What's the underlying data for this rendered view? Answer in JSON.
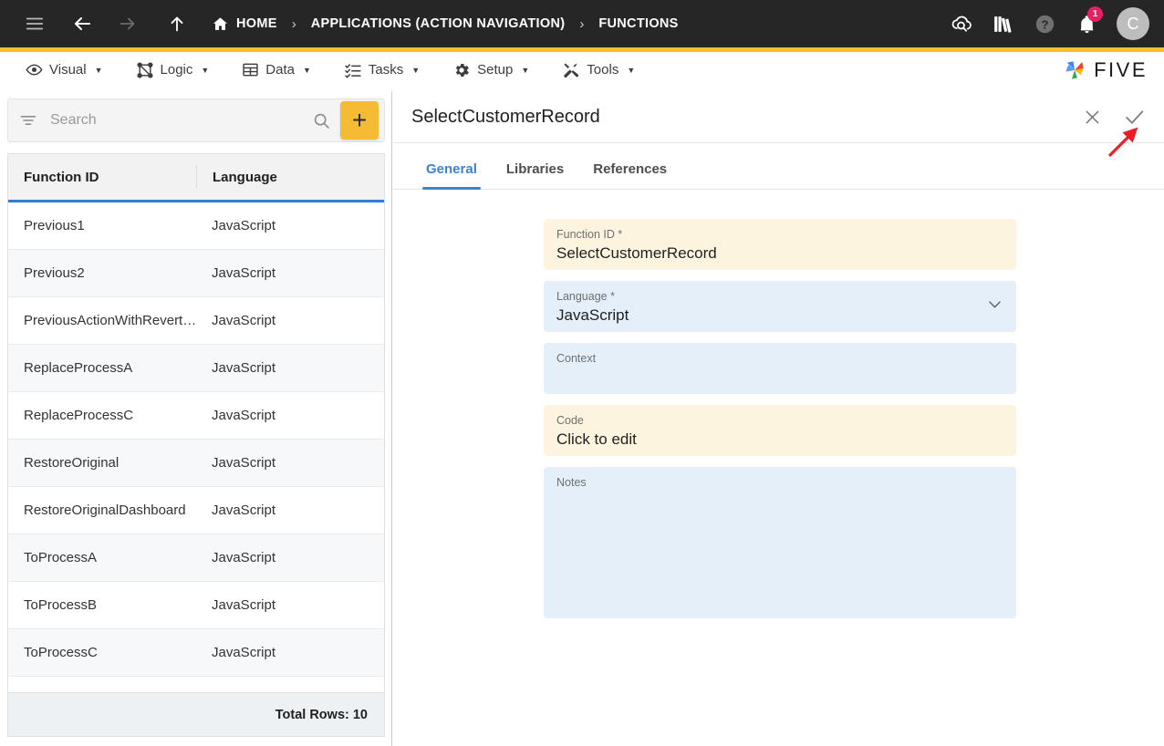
{
  "header": {
    "nav_icons": [
      {
        "name": "menu-icon",
        "label": "Menu"
      },
      {
        "name": "back-arrow-icon",
        "label": "Back"
      },
      {
        "name": "forward-arrow-icon",
        "label": "Forward"
      },
      {
        "name": "up-arrow-icon",
        "label": "Up"
      }
    ],
    "breadcrumb": [
      {
        "label": "HOME",
        "icon": "home-icon"
      },
      {
        "label": "APPLICATIONS (ACTION NAVIGATION)",
        "icon": ""
      },
      {
        "label": "FUNCTIONS",
        "icon": ""
      }
    ],
    "separator": "›",
    "right_icons": [
      {
        "name": "cloud-search-icon",
        "label": "Cloud Search"
      },
      {
        "name": "library-books-icon",
        "label": "Library"
      },
      {
        "name": "help-icon",
        "label": "Help"
      },
      {
        "name": "notifications-bell-icon",
        "label": "Notifications"
      }
    ],
    "notification_count": "1",
    "avatar_initial": "C",
    "accent_color": "#f9bf2c",
    "background_color": "#262626"
  },
  "menubar": {
    "items": [
      {
        "label": "Visual",
        "icon": "eye-icon"
      },
      {
        "label": "Logic",
        "icon": "logic-nodes-icon"
      },
      {
        "label": "Data",
        "icon": "table-grid-icon"
      },
      {
        "label": "Tasks",
        "icon": "checklist-icon"
      },
      {
        "label": "Setup",
        "icon": "gear-icon"
      },
      {
        "label": "Tools",
        "icon": "tools-wrench-icon"
      }
    ],
    "caret": "▼",
    "logo_text": "FIVE"
  },
  "list_panel": {
    "search": {
      "placeholder": "Search",
      "value": "",
      "filter_icon": "filter-icon",
      "search_icon": "search-icon"
    },
    "add_button_label": "+",
    "add_button_color": "#f6bb34",
    "columns": [
      "Function ID",
      "Language"
    ],
    "header_underline_color": "#2f7fd4",
    "rows": [
      {
        "function_id": "Previous1",
        "language": "JavaScript"
      },
      {
        "function_id": "Previous2",
        "language": "JavaScript"
      },
      {
        "function_id": "PreviousActionWithRevert…",
        "language": "JavaScript"
      },
      {
        "function_id": "ReplaceProcessA",
        "language": "JavaScript"
      },
      {
        "function_id": "ReplaceProcessC",
        "language": "JavaScript"
      },
      {
        "function_id": "RestoreOriginal",
        "language": "JavaScript"
      },
      {
        "function_id": "RestoreOriginalDashboard",
        "language": "JavaScript"
      },
      {
        "function_id": "ToProcessA",
        "language": "JavaScript"
      },
      {
        "function_id": "ToProcessB",
        "language": "JavaScript"
      },
      {
        "function_id": "ToProcessC",
        "language": "JavaScript"
      }
    ],
    "footer_text": "Total Rows: 10"
  },
  "detail_panel": {
    "title": "SelectCustomerRecord",
    "close_icon": "close-icon",
    "save_icon": "checkmark-save-icon",
    "tabs": [
      {
        "label": "General",
        "active": true
      },
      {
        "label": "Libraries",
        "active": false
      },
      {
        "label": "References",
        "active": false
      }
    ],
    "active_tab_color": "#3b82d6",
    "fields": [
      {
        "label": "Function ID *",
        "value": "SelectCustomerRecord",
        "style": "cream"
      },
      {
        "label": "Language *",
        "value": "JavaScript",
        "style": "blue",
        "dropdown": true
      },
      {
        "label": "Context",
        "value": "",
        "style": "blue"
      },
      {
        "label": "Code",
        "value": "Click to edit",
        "style": "cream"
      },
      {
        "label": "Notes",
        "value": "",
        "style": "blue",
        "multiline": true
      }
    ]
  },
  "annotation": {
    "arrow_color": "#ee1c24",
    "points_at": "checkmark-save-icon"
  }
}
